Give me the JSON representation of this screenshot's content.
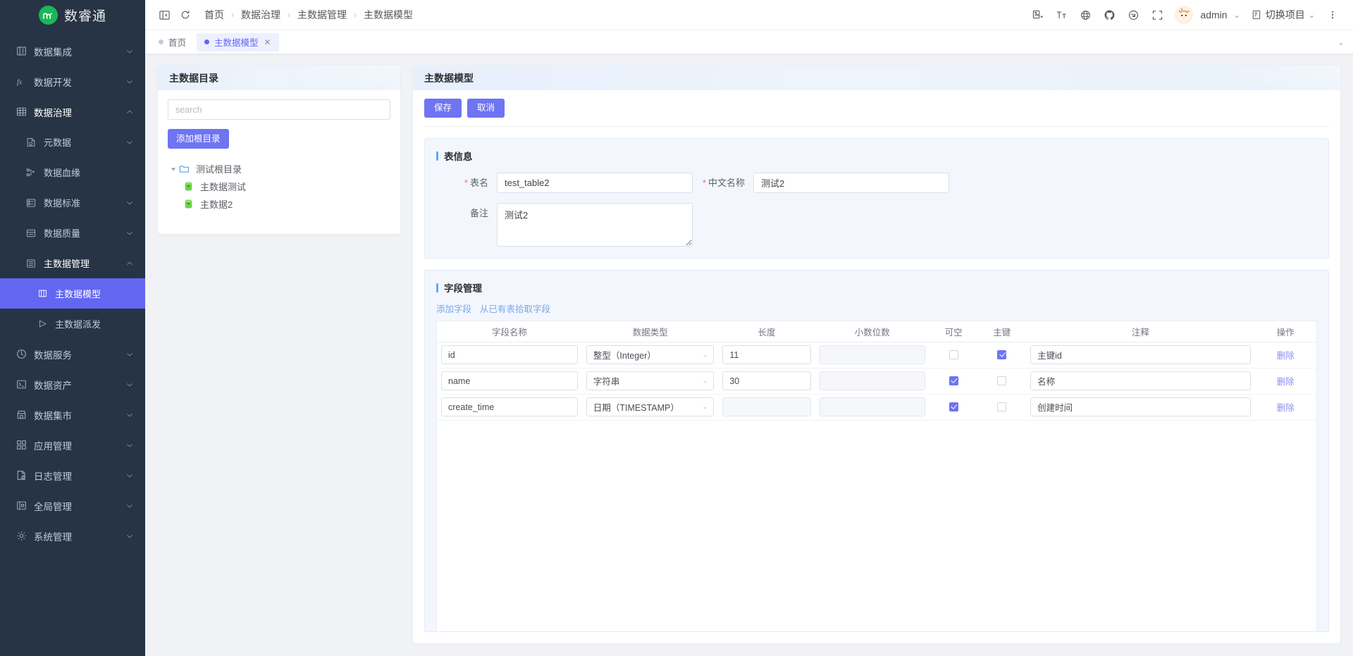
{
  "app": {
    "logo_text": "数睿通",
    "logo_glyph": "⋔"
  },
  "sidebar": {
    "items": [
      {
        "label": "数据集成",
        "icon": "integration-icon",
        "level": 1,
        "expandable": true,
        "expanded": false
      },
      {
        "label": "数据开发",
        "icon": "fx-icon",
        "level": 1,
        "expandable": true,
        "expanded": false
      },
      {
        "label": "数据治理",
        "icon": "governance-icon",
        "level": 1,
        "expandable": true,
        "expanded": true
      },
      {
        "label": "元数据",
        "icon": "metadata-icon",
        "level": 2,
        "expandable": true,
        "expanded": false
      },
      {
        "label": "数据血缘",
        "icon": "lineage-icon",
        "level": 2,
        "expandable": false,
        "expanded": false
      },
      {
        "label": "数据标准",
        "icon": "standard-icon",
        "level": 2,
        "expandable": true,
        "expanded": false
      },
      {
        "label": "数据质量",
        "icon": "quality-icon",
        "level": 2,
        "expandable": true,
        "expanded": false
      },
      {
        "label": "主数据管理",
        "icon": "masterdata-icon",
        "level": 2,
        "expandable": true,
        "expanded": true
      },
      {
        "label": "主数据模型",
        "icon": "model-icon",
        "level": 3,
        "expandable": false,
        "expanded": false,
        "selected": true
      },
      {
        "label": "主数据派发",
        "icon": "dispatch-icon",
        "level": 3,
        "expandable": false,
        "expanded": false
      },
      {
        "label": "数据服务",
        "icon": "service-icon",
        "level": 1,
        "expandable": true,
        "expanded": false
      },
      {
        "label": "数据资产",
        "icon": "asset-icon",
        "level": 1,
        "expandable": true,
        "expanded": false
      },
      {
        "label": "数据集市",
        "icon": "mart-icon",
        "level": 1,
        "expandable": true,
        "expanded": false
      },
      {
        "label": "应用管理",
        "icon": "app-icon",
        "level": 1,
        "expandable": true,
        "expanded": false
      },
      {
        "label": "日志管理",
        "icon": "log-icon",
        "level": 1,
        "expandable": true,
        "expanded": false
      },
      {
        "label": "全局管理",
        "icon": "global-icon",
        "level": 1,
        "expandable": true,
        "expanded": false
      },
      {
        "label": "系统管理",
        "icon": "gear-icon",
        "level": 1,
        "expandable": true,
        "expanded": false
      }
    ]
  },
  "topbar": {
    "collapse_icon": "collapse-menu-icon",
    "refresh_icon": "refresh-icon",
    "breadcrumb": [
      "首页",
      "数据治理",
      "主数据管理",
      "主数据模型"
    ],
    "separator": "›",
    "right_icons": [
      "screenshot-icon",
      "font-size-icon",
      "language-icon",
      "github-icon",
      "gitee-icon",
      "fullscreen-icon"
    ],
    "user_name": "admin",
    "switch_project_label": "切换项目",
    "more_icon": "more-vertical-icon"
  },
  "tabs": {
    "items": [
      {
        "label": "首页",
        "active": false,
        "closable": false
      },
      {
        "label": "主数据模型",
        "active": true,
        "closable": true
      }
    ],
    "close_glyph": "✕",
    "overflow_glyph": "⌄"
  },
  "catalog": {
    "title": "主数据目录",
    "search_placeholder": "search",
    "search_value": "",
    "add_root_label": "添加根目录",
    "tree": [
      {
        "label": "测试根目录",
        "icon": "folder-icon",
        "level": 0,
        "expanded": true
      },
      {
        "label": "主数据测试",
        "icon": "database-icon",
        "level": 1
      },
      {
        "label": "主数据2",
        "icon": "database-icon",
        "level": 1
      }
    ]
  },
  "model": {
    "title": "主数据模型",
    "save_label": "保存",
    "cancel_label": "取消",
    "table_info": {
      "section_title": "表信息",
      "table_name_label": "表名",
      "table_name_value": "test_table2",
      "cn_name_label": "中文名称",
      "cn_name_value": "测试2",
      "remark_label": "备注",
      "remark_value": "测试2"
    },
    "fields": {
      "section_title": "字段管理",
      "add_field_label": "添加字段",
      "pick_field_label": "从已有表拾取字段",
      "columns": [
        "字段名称",
        "数据类型",
        "长度",
        "小数位数",
        "可空",
        "主键",
        "注释",
        "操作"
      ],
      "delete_label": "删除",
      "rows": [
        {
          "name": "id",
          "type": "整型（Integer）",
          "length": "11",
          "scale": "",
          "scale_disabled": true,
          "nullable": false,
          "primary": true,
          "comment": "主键id"
        },
        {
          "name": "name",
          "type": "字符串",
          "length": "30",
          "scale": "",
          "scale_disabled": true,
          "nullable": true,
          "primary": false,
          "comment": "名称"
        },
        {
          "name": "create_time",
          "type": "日期（TIMESTAMP）",
          "length": "",
          "scale": "",
          "length_disabled": true,
          "scale_disabled": true,
          "nullable": true,
          "primary": false,
          "comment": "创建时间"
        }
      ]
    }
  },
  "colors": {
    "accent": "#6366f1",
    "button": "#6f74f2",
    "sidebar_bg": "#263445",
    "panel_bg": "#f3f6fd",
    "scrollbar": "#ff8c1a"
  }
}
